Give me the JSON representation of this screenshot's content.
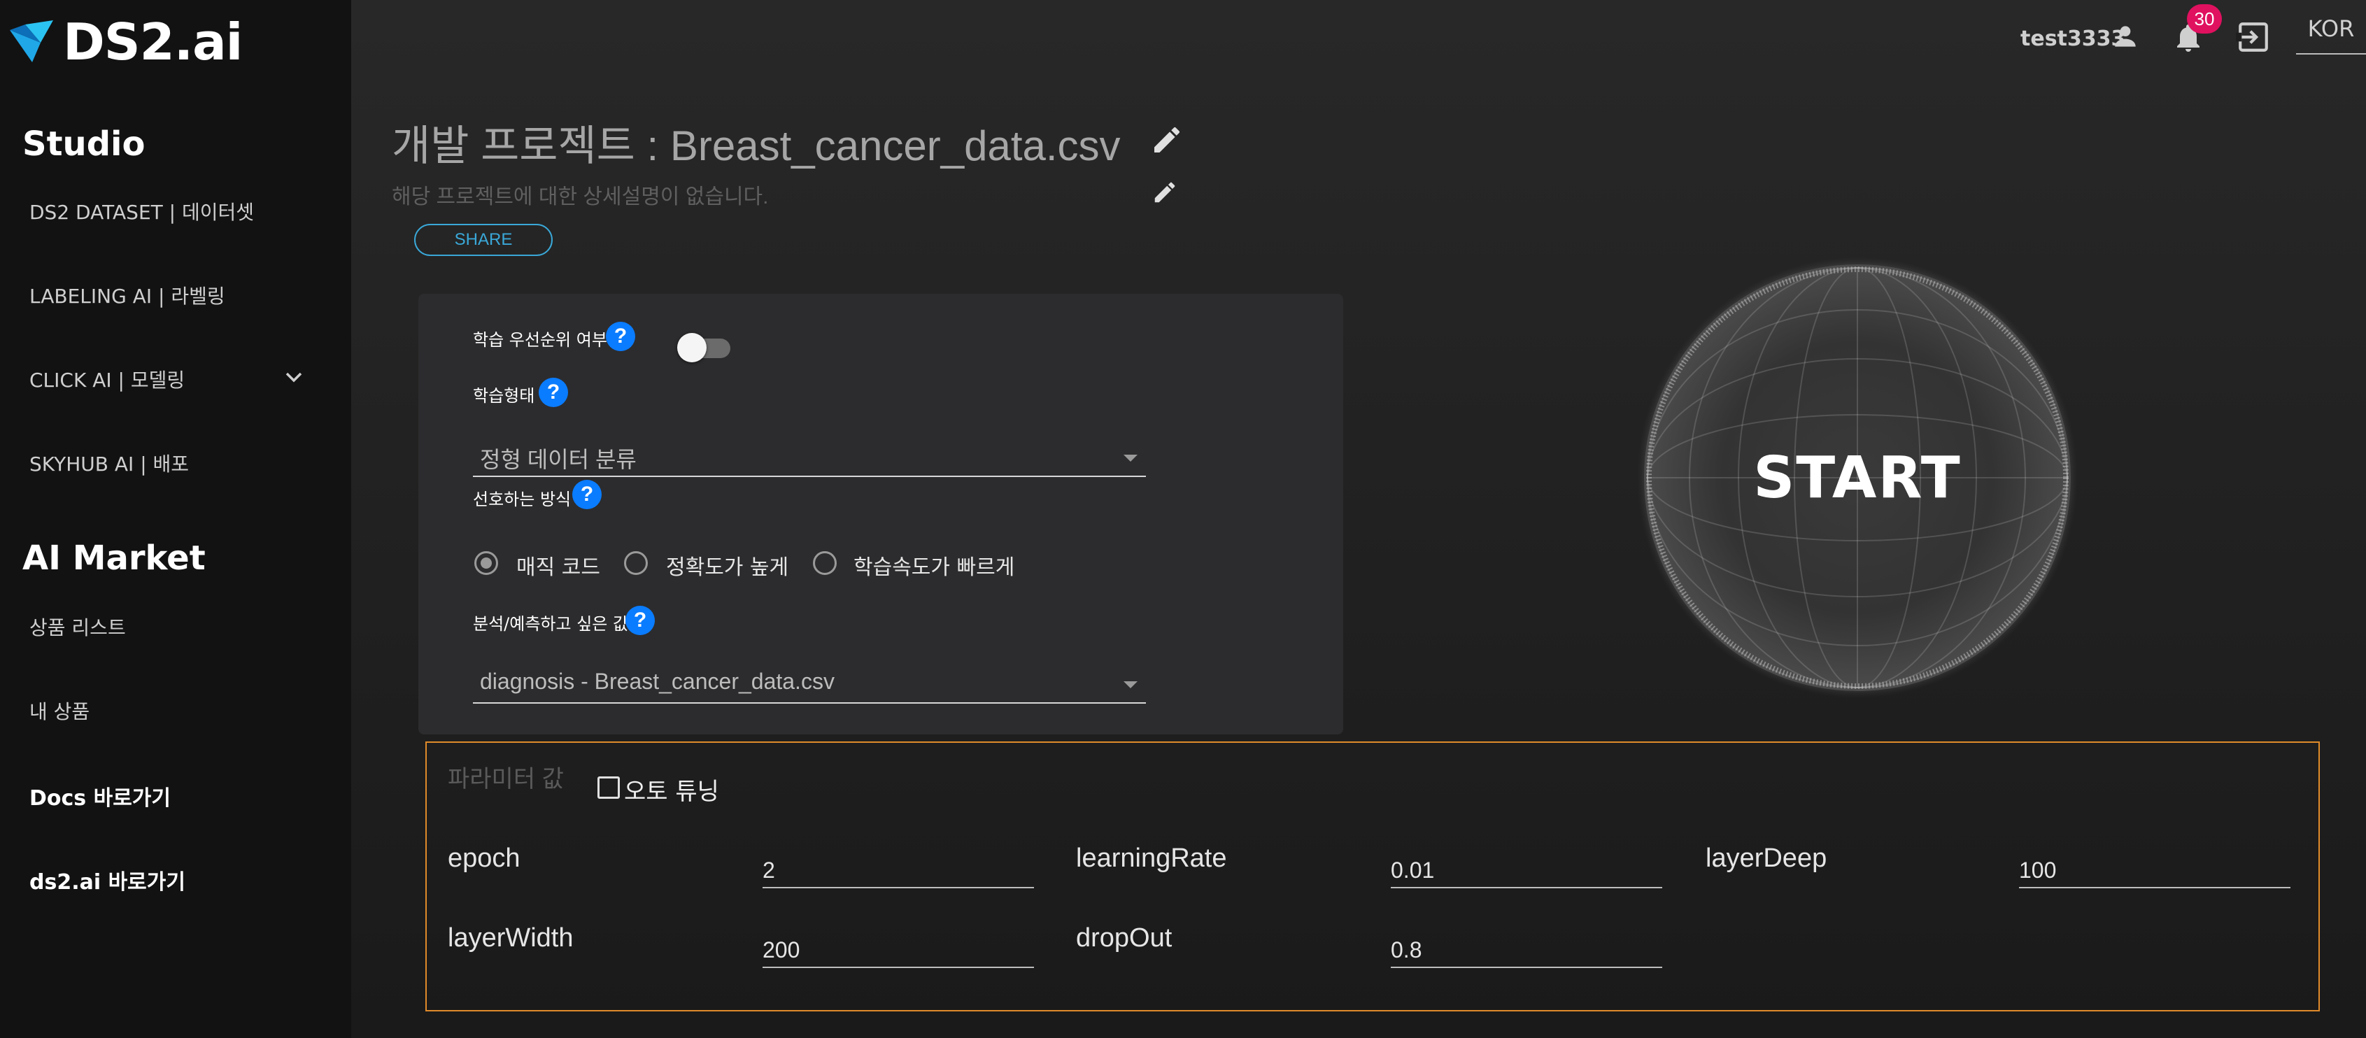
{
  "brand": {
    "name": "DS2.ai"
  },
  "sidebar": {
    "studio_title": "Studio",
    "studio_items": [
      {
        "label": "DS2 DATASET | 데이터셋"
      },
      {
        "label": "LABELING AI | 라벨링"
      },
      {
        "label": "CLICK AI | 모델링"
      },
      {
        "label": "SKYHUB AI | 배포"
      }
    ],
    "market_title": "AI Market",
    "market_items": [
      {
        "label": "상품 리스트"
      },
      {
        "label": "내 상품"
      }
    ],
    "links": [
      {
        "label": "Docs 바로가기"
      },
      {
        "label": "ds2.ai 바로가기"
      }
    ]
  },
  "header": {
    "username": "test3333",
    "notification_count": "30",
    "language": "KOR"
  },
  "project": {
    "title": "개발 프로젝트 : Breast_cancer_data.csv",
    "description": "해당 프로젝트에 대한 상세설명이 없습니다.",
    "share_label": "SHARE"
  },
  "settings": {
    "priority_label": "학습 우선순위 여부",
    "priority_enabled": false,
    "training_type_label": "학습형태",
    "training_type_value": "정형 데이터 분류",
    "preferred_method_label": "선호하는 방식",
    "methods": [
      {
        "label": "매직 코드",
        "selected": true
      },
      {
        "label": "정확도가 높게",
        "selected": false
      },
      {
        "label": "학습속도가 빠르게",
        "selected": false
      }
    ],
    "target_label": "분석/예측하고 싶은 값",
    "target_value": "diagnosis - Breast_cancer_data.csv",
    "help_glyph": "?"
  },
  "start": {
    "label": "START"
  },
  "params": {
    "title": "파라미터 값",
    "auto_tuning_label": "오토 튜닝",
    "auto_tuning_checked": false,
    "fields": [
      {
        "name": "epoch",
        "value": "2"
      },
      {
        "name": "learningRate",
        "value": "0.01"
      },
      {
        "name": "layerDeep",
        "value": "100"
      },
      {
        "name": "layerWidth",
        "value": "200"
      },
      {
        "name": "dropOut",
        "value": "0.8"
      }
    ]
  },
  "colors": {
    "accent_blue": "#0a7cff",
    "share_border": "#3aa8d8",
    "param_border": "#e08a2a",
    "badge": "#e0115f"
  }
}
